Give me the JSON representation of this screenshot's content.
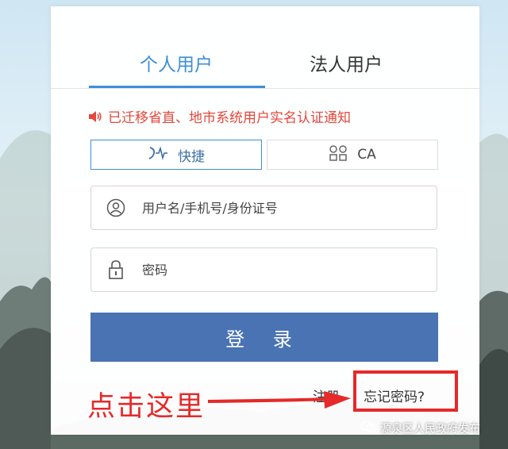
{
  "tabs": [
    {
      "label": "个人用户",
      "active": true
    },
    {
      "label": "法人用户",
      "active": false
    }
  ],
  "notice": {
    "text": "已迁移省直、地市系统用户实名认证通知",
    "icon": "speaker-icon"
  },
  "login_modes": [
    {
      "label": "快捷",
      "icon": "quick-login-icon",
      "selected": true
    },
    {
      "label": "CA",
      "icon": "ca-cert-icon",
      "selected": false
    }
  ],
  "username_field": {
    "placeholder": "用户名/手机号/身份证号",
    "value": "",
    "icon": "user-icon"
  },
  "password_field": {
    "placeholder": "密码",
    "value": "",
    "icon": "lock-icon"
  },
  "login_button": {
    "label": "登 录"
  },
  "links": {
    "register": "注册",
    "forgot_password": "忘记密码?"
  },
  "annotation": {
    "text": "点击这里"
  },
  "watermark": {
    "text": "源泉区人民政府发布"
  },
  "colors": {
    "accent": "#3c8fd6",
    "button": "#4a73b4",
    "notice": "#e4473b",
    "annotation": "#e62929"
  }
}
